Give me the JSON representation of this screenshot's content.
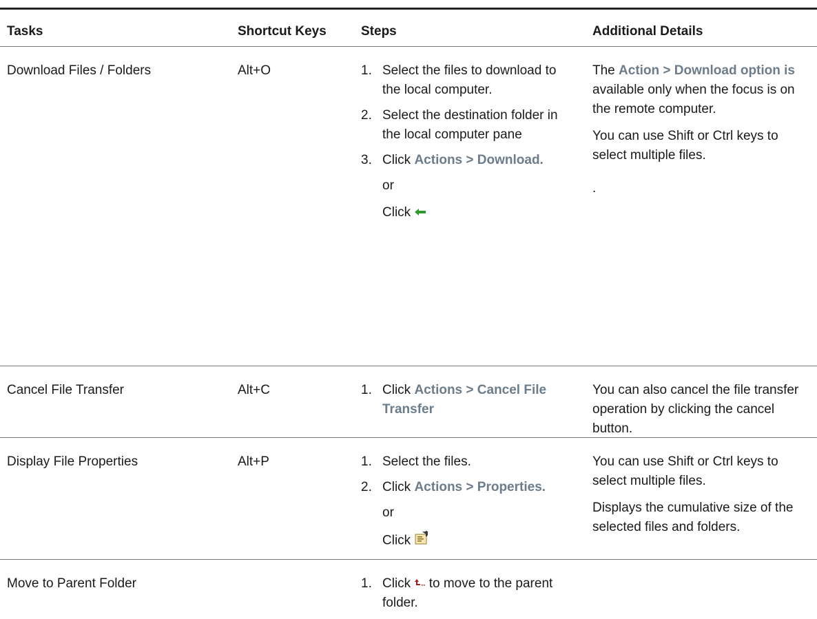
{
  "headers": {
    "tasks": "Tasks",
    "shortcut": "Shortcut Keys",
    "steps": "Steps",
    "details": "Additional Details"
  },
  "rows": [
    {
      "task": "Download Files / Folders",
      "shortcut": "Alt+O",
      "step1": "Select the files to download to the local computer.",
      "step2": "Select the destination folder in the local computer pane",
      "step3_prefix": "Click ",
      "step3_bold": "Actions > Download.",
      "or": "or",
      "click": "Click",
      "details1_pre": "The ",
      "details1_bold": "Action > Download option is",
      "details1_post": " available only when the focus is on the remote computer.",
      "details2": "You can use Shift or Ctrl keys to select multiple files.",
      "details3": "."
    },
    {
      "task": "Cancel File Transfer",
      "shortcut": "Alt+C",
      "step1_prefix": "Click ",
      "step1_bold": "Actions > Cancel File Transfer",
      "details1": "You can also cancel the file transfer operation by clicking the cancel button."
    },
    {
      "task": "Display File Properties",
      "shortcut": "Alt+P",
      "step1": "Select the files.",
      "step2_prefix": "Click ",
      "step2_bold": "Actions > Properties.",
      "or": "or",
      "click": "Click",
      "details1": "You can use Shift or Ctrl keys to select multiple files.",
      "details2": "Displays the cumulative size of the selected files and folders."
    },
    {
      "task": "Move to Parent Folder",
      "shortcut": "",
      "step1_prefix": "Click",
      "step1_suffix": " to move to the parent folder."
    }
  ],
  "numbers": [
    "1.",
    "2.",
    "3."
  ],
  "icons": {
    "download": "green-left-arrow-icon",
    "properties": "properties-icon",
    "parent": "up-to-parent-icon"
  },
  "colors": {
    "emphasis": "#6b7c8b",
    "download_arrow": "#2e9a2e",
    "parent_arrow": "#a02020"
  }
}
